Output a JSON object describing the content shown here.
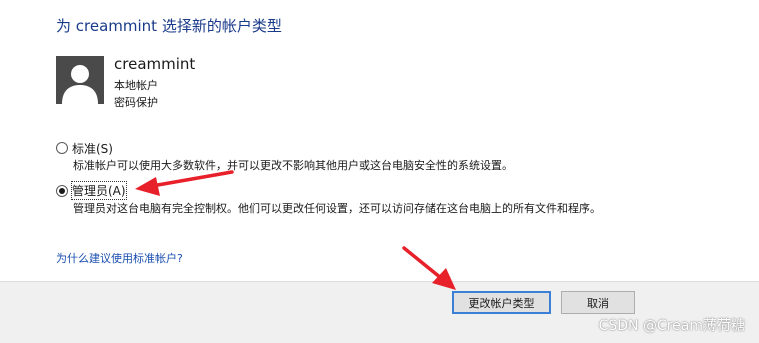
{
  "dialog": {
    "title": "为 creammint 选择新的帐户类型"
  },
  "user": {
    "name": "creammint",
    "account_type": "本地帐户",
    "security": "密码保护"
  },
  "options": [
    {
      "label": "标准(S)",
      "description": "标准帐户可以使用大多数软件，并可以更改不影响其他用户或这台电脑安全性的系统设置。",
      "selected": false
    },
    {
      "label": "管理员(A)",
      "description": "管理员对这台电脑有完全控制权。他们可以更改任何设置，还可以访问存储在这台电脑上的所有文件和程序。",
      "selected": true
    }
  ],
  "help_link": "为什么建议使用标准帐户?",
  "buttons": {
    "confirm": "更改帐户类型",
    "cancel": "取消"
  },
  "watermark": "CSDN @Cream薄荷糖",
  "colors": {
    "annotation_arrow": "#e8202a",
    "title": "#1a3a8a",
    "link": "#1a4fb0"
  }
}
